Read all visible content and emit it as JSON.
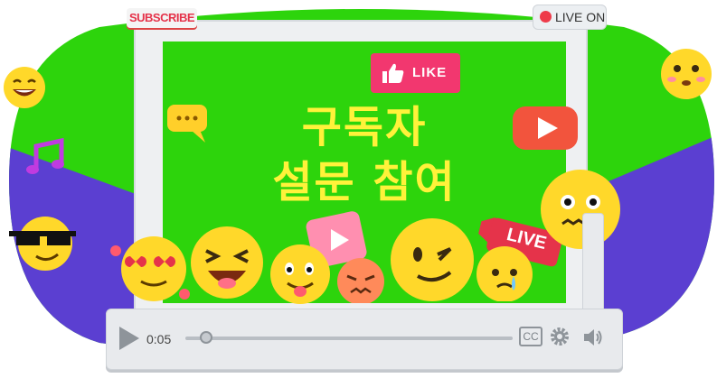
{
  "header": {
    "subscribe_label": "SUBSCRIBE",
    "live_on_label": "LIVE ON"
  },
  "screen": {
    "like_label": "LIKE",
    "title_line1": "구독자",
    "title_line2": "설문 참여",
    "live_tag_label": "LIVE"
  },
  "player": {
    "time": "0:05",
    "cc_label": "CC",
    "progress": 0.04
  },
  "icons": [
    "thumbs-up-icon",
    "play-icon",
    "speech-bubble-icon",
    "music-note-icon",
    "gear-icon",
    "volume-icon"
  ],
  "colors": {
    "screen_green": "#2dd40c",
    "title_yellow": "#fff23a",
    "like_pink": "#f2376f",
    "play_red": "#f2543d",
    "purple_bg": "#5b3fd1",
    "emoji_yellow": "#ffd82a"
  }
}
